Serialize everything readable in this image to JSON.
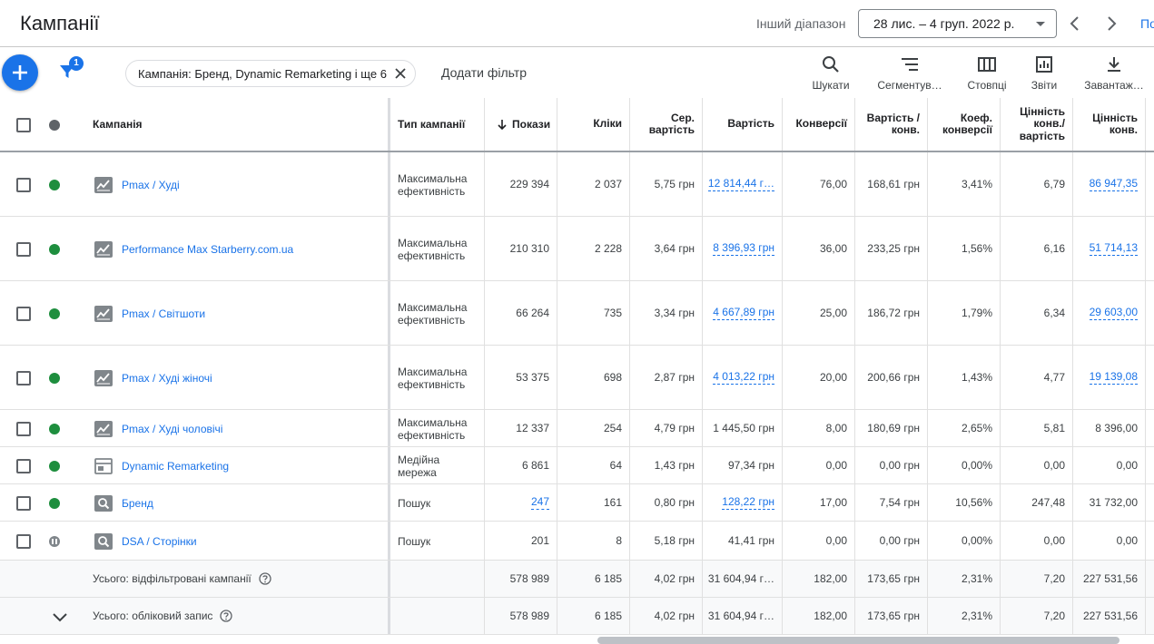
{
  "header": {
    "title": "Кампанії",
    "range_label": "Інший діапазон",
    "date_range": "28 лис. – 4 груп. 2022 р.",
    "cut_link": "По"
  },
  "toolbar": {
    "filter_count": "1",
    "filter_chip": "Кампанія: Бренд, Dynamic Remarketing і ще 6",
    "add_filter": "Додати фільтр",
    "tools": [
      {
        "icon": "search-icon",
        "label": "Шукати"
      },
      {
        "icon": "segment-icon",
        "label": "Сегментув…"
      },
      {
        "icon": "columns-icon",
        "label": "Стовпці"
      },
      {
        "icon": "reports-icon",
        "label": "Звіти"
      },
      {
        "icon": "download-icon",
        "label": "Завантаж…"
      }
    ]
  },
  "table": {
    "columns": {
      "campaign": "Кампанія",
      "type": "Тип кампанії",
      "impressions": "Покази",
      "clicks": "Кліки",
      "avg_cpc": "Сер. вартість",
      "cost": "Вартість",
      "conversions": "Конверсії",
      "cost_per_conv": "Вартість / конв.",
      "conv_rate": "Коеф. конверсії",
      "conv_value_cost": "Цінність конв./ вартість",
      "conv_value": "Цінність конв."
    },
    "rows": [
      {
        "status": "enabled",
        "type_icon": "pmax-icon",
        "name": "Pmax / Худі",
        "type": "Максимальна ефективність",
        "impressions": "229 394",
        "clicks": "2 037",
        "avg_cpc": "5,75 грн",
        "cost": "12 814,44 г…",
        "conversions": "76,00",
        "cost_per_conv": "168,61 грн",
        "conv_rate": "3,41%",
        "conv_value_cost": "6,79",
        "conv_value": "86 947,35"
      },
      {
        "status": "enabled",
        "type_icon": "pmax-icon",
        "name": "Performance Max Starberry.com.ua",
        "type": "Максимальна ефективність",
        "impressions": "210 310",
        "clicks": "2 228",
        "avg_cpc": "3,64 грн",
        "cost": "8 396,93 грн",
        "conversions": "36,00",
        "cost_per_conv": "233,25 грн",
        "conv_rate": "1,56%",
        "conv_value_cost": "6,16",
        "conv_value": "51 714,13"
      },
      {
        "status": "enabled",
        "type_icon": "pmax-icon",
        "name": "Pmax / Світшоти",
        "type": "Максимальна ефективність",
        "impressions": "66 264",
        "clicks": "735",
        "avg_cpc": "3,34 грн",
        "cost": "4 667,89 грн",
        "conversions": "25,00",
        "cost_per_conv": "186,72 грн",
        "conv_rate": "1,79%",
        "conv_value_cost": "6,34",
        "conv_value": "29 603,00"
      },
      {
        "status": "enabled",
        "type_icon": "pmax-icon",
        "name": "Pmax / Худі жіночі",
        "type": "Максимальна ефективність",
        "impressions": "53 375",
        "clicks": "698",
        "avg_cpc": "2,87 грн",
        "cost": "4 013,22 грн",
        "conversions": "20,00",
        "cost_per_conv": "200,66 грн",
        "conv_rate": "1,43%",
        "conv_value_cost": "4,77",
        "conv_value": "19 139,08"
      },
      {
        "status": "enabled",
        "type_icon": "pmax-icon",
        "name": "Pmax / Худі чоловічі",
        "type": "Максимальна ефективність",
        "impressions": "12 337",
        "clicks": "254",
        "avg_cpc": "4,79 грн",
        "cost": "1 445,50 грн",
        "conversions": "8,00",
        "cost_per_conv": "180,69 грн",
        "conv_rate": "2,65%",
        "conv_value_cost": "5,81",
        "conv_value": "8 396,00"
      },
      {
        "status": "enabled",
        "type_icon": "display-icon",
        "name": "Dynamic Remarketing",
        "type": "Медійна мережа",
        "impressions": "6 861",
        "clicks": "64",
        "avg_cpc": "1,43 грн",
        "cost": "97,34 грн",
        "conversions": "0,00",
        "cost_per_conv": "0,00 грн",
        "conv_rate": "0,00%",
        "conv_value_cost": "0,00",
        "conv_value": "0,00"
      },
      {
        "status": "enabled",
        "type_icon": "search-campaign-icon",
        "name": "Бренд",
        "type": "Пошук",
        "impressions": "247",
        "clicks": "161",
        "avg_cpc": "0,80 грн",
        "cost": "128,22 грн",
        "conversions": "17,00",
        "cost_per_conv": "7,54 грн",
        "conv_rate": "10,56%",
        "conv_value_cost": "247,48",
        "conv_value": "31 732,00"
      },
      {
        "status": "paused",
        "type_icon": "search-campaign-icon",
        "name": "DSA / Сторінки",
        "type": "Пошук",
        "impressions": "201",
        "clicks": "8",
        "avg_cpc": "5,18 грн",
        "cost": "41,41 грн",
        "conversions": "0,00",
        "cost_per_conv": "0,00 грн",
        "conv_rate": "0,00%",
        "conv_value_cost": "0,00",
        "conv_value": "0,00"
      }
    ],
    "totals": [
      {
        "label": "Усього: відфільтровані кампанії",
        "impressions": "578 989",
        "clicks": "6 185",
        "avg_cpc": "4,02 грн",
        "cost": "31 604,94 г…",
        "conversions": "182,00",
        "cost_per_conv": "173,65 грн",
        "conv_rate": "2,31%",
        "conv_value_cost": "7,20",
        "conv_value": "227 531,56"
      },
      {
        "label": "Усього: обліковий запис",
        "impressions": "578 989",
        "clicks": "6 185",
        "avg_cpc": "4,02 грн",
        "cost": "31 604,94 г…",
        "conversions": "182,00",
        "cost_per_conv": "173,65 грн",
        "conv_rate": "2,31%",
        "conv_value_cost": "7,20",
        "conv_value": "227 531,56"
      }
    ]
  },
  "colors": {
    "accent": "#1a73e8",
    "enabled": "#1e8e3e",
    "paused": "#80868b"
  }
}
